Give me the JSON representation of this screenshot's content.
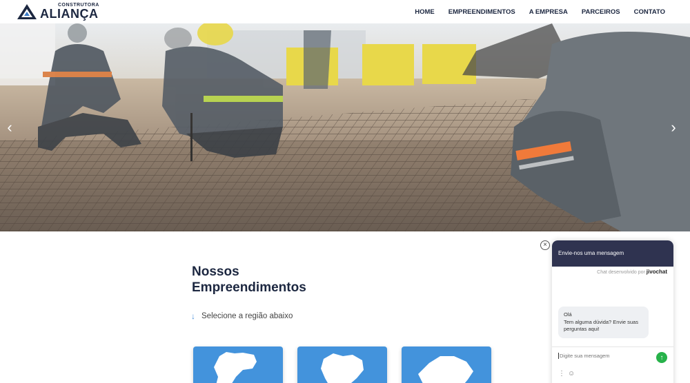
{
  "brand": {
    "sub": "Construtora",
    "name": "ALIANÇA"
  },
  "nav": {
    "items": [
      {
        "label": "HOME"
      },
      {
        "label": "EMPREENDIMENTOS"
      },
      {
        "label": "A EMPRESA"
      },
      {
        "label": "PARCEIROS"
      },
      {
        "label": "CONTATO"
      }
    ]
  },
  "hero": {
    "prev_icon": "chevron-left-icon",
    "next_icon": "chevron-right-icon"
  },
  "section": {
    "title_line1": "Nossos",
    "title_line2": "Empreendimentos",
    "hint": "Selecione a região abaixo"
  },
  "regions": {
    "card_color": "#4393dc"
  },
  "chat": {
    "header": "Envie-nos uma mensagem",
    "powered_prefix": "Chat desenvolvido por",
    "powered_brand": "jivochat",
    "message_line1": "Olá",
    "message_line2": "Tem alguma dúvida? Envie suas perguntas aqui!",
    "input_placeholder": "Digite sua mensagem",
    "accent": "#2f3350",
    "send_color": "#27b24a"
  },
  "colors": {
    "brand_navy": "#1c2740",
    "accent_blue": "#4a90d9"
  }
}
